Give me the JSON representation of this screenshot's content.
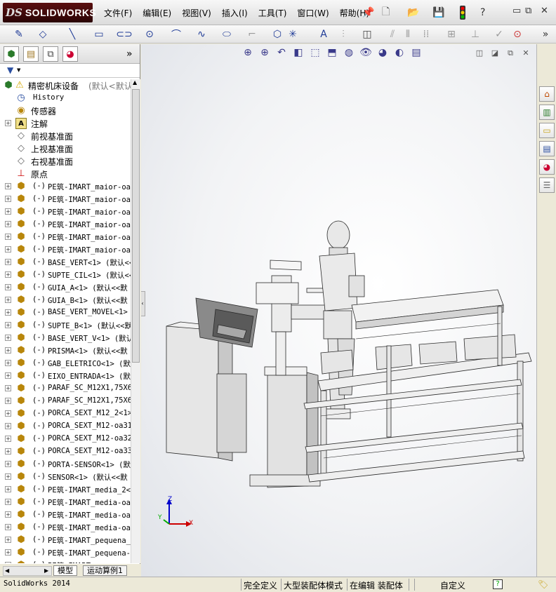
{
  "app": {
    "brand_ds": "DS",
    "brand_name": "SOLIDWORKS"
  },
  "menu": [
    "文件(F)",
    "编辑(E)",
    "视图(V)",
    "插入(I)",
    "工具(T)",
    "窗口(W)",
    "帮助(H)"
  ],
  "panel": {
    "root_label": "精密机床设备",
    "root_config": "(默认<默认",
    "items": [
      {
        "label": "History",
        "icon": "history-icon",
        "expandable": false,
        "mono": true
      },
      {
        "label": "传感器",
        "icon": "sensor-icon",
        "expandable": false
      },
      {
        "label": "注解",
        "icon": "annotation-icon",
        "expandable": true
      },
      {
        "label": "前视基准面",
        "icon": "plane-icon",
        "expandable": false
      },
      {
        "label": "上视基准面",
        "icon": "plane-icon",
        "expandable": false
      },
      {
        "label": "右视基准面",
        "icon": "plane-icon",
        "expandable": false
      },
      {
        "label": "原点",
        "icon": "origin-icon",
        "expandable": false
      }
    ],
    "components": [
      "PE筑-IMART_maior-oa2",
      "PE筑-IMART_maior-oa2",
      "PE筑-IMART_maior-oa2",
      "PE筑-IMART_maior-oa2",
      "PE筑-IMART_maior-oa2",
      "PE筑-IMART_maior-oa2",
      "BASE_VERT<1> (默认<<",
      "SUPTE_CIL<1> (默认<<",
      "GUIA_A<1> (默认<<默",
      "GUIA_B<1> (默认<<默",
      "BASE_VERT_MOVEL<1>",
      "SUPTE_B<1> (默认<<默",
      "BASE_VERT_V<1> (默认",
      "PRISMA<1> (默认<<默",
      "GAB_ELETRICO<1> (默",
      "EIXO_ENTRADA<1> (默",
      "PARAF_SC_M12X1,75X6",
      "PARAF_SC_M12X1,75X6",
      "PORCA_SEXT_M12_2<1>",
      "PORCA_SEXT_M12-oa31",
      "PORCA_SEXT_M12-oa32",
      "PORCA_SEXT_M12-oa33",
      "PORTA-SENSOR<1> (默",
      "SENSOR<1> (默认<<默",
      "PE筑-IMART_media_2<",
      "PE筑-IMART_media-oa2",
      "PE筑-IMART_media-oa2",
      "PE筑-IMART_media-oa2",
      "PE筑-IMART_pequena_2",
      "PE筑-IMART_pequena-",
      "PE筑-IMART_"
    ],
    "component_prefix": "(-)",
    "bottom_tabs": [
      "模型",
      "运动算例1"
    ]
  },
  "status": {
    "app_version": "SolidWorks 2014",
    "defined": "完全定义",
    "mode": "大型装配体模式",
    "editing": "在编辑 装配体",
    "custom": "自定义"
  },
  "triad": {
    "x": "X",
    "y": "Y",
    "z": "Z"
  },
  "colors": {
    "logo": "#4a0a0b",
    "part_fill": "#d9d9d9",
    "part_edge": "#2a2a2a",
    "axis_x": "#cc0000",
    "axis_y": "#00aa00",
    "axis_z": "#0000cc"
  }
}
